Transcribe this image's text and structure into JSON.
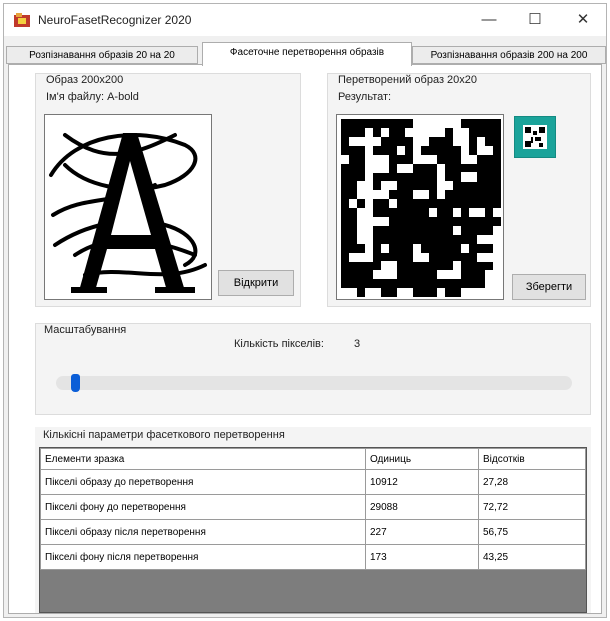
{
  "window": {
    "title": "NeuroFasetRecognizer 2020",
    "minimize_glyph": "—",
    "maximize_glyph": "☐",
    "close_glyph": "✕",
    "app_icon": "app-icon"
  },
  "tabs": [
    {
      "label": "Розпізнавання образів 20 на 20",
      "active": false
    },
    {
      "label": "Фасеточне перетворення образів",
      "active": true
    },
    {
      "label": "Розпізнавання образів 200 на 200",
      "active": false
    }
  ],
  "source": {
    "group_title": "Образ 200x200",
    "file_label": "Ім'я файлу: A-bold",
    "open_button": "Відкрити"
  },
  "result": {
    "group_title": "Перетворений образ  20x20",
    "result_label": "Результат:",
    "save_button": "Зберегти",
    "preview_icon": "qr-preview-icon",
    "grid": [
      "11111111100000011111",
      "11101011000001001111",
      "10000111100111001011",
      "11101110101111101001",
      "01100011100011100111",
      "11100010011101111111",
      "11101111111101100111",
      "11001001111100111111",
      "11000011100101111111",
      "10101101111111111111",
      "11001111111011010010",
      "11000011111111111111",
      "11001111111111011110",
      "11001111111111111000",
      "11101011101111101110",
      "10001111100111111000",
      "11111001111111011110",
      "11110001111100011100",
      "11111111111111111100",
      "00100110011101100000"
    ]
  },
  "scaling": {
    "group_title": "Масштабування",
    "pixel_count_label": "Кількість пікселів:",
    "pixel_count_value": "3",
    "slider_fraction": 0.03
  },
  "params": {
    "group_title": "Кількісні параметри фасеткового перетворення",
    "columns": [
      "Елементи зразка",
      "Одиниць",
      "Відсотків"
    ],
    "rows": [
      [
        "Пікселі образу до перетворення",
        "10912",
        "27,28"
      ],
      [
        "Пікселі фону до перетворення",
        "29088",
        "72,72"
      ],
      [
        "Пікселі образу після перетворення",
        "227",
        "56,75"
      ],
      [
        "Пікселі фону після перетворення",
        "173",
        "43,25"
      ]
    ]
  },
  "colors": {
    "accent": "#0b5ed7",
    "preview_bg": "#1aa39a",
    "grid_empty": "#7a7a7a"
  }
}
